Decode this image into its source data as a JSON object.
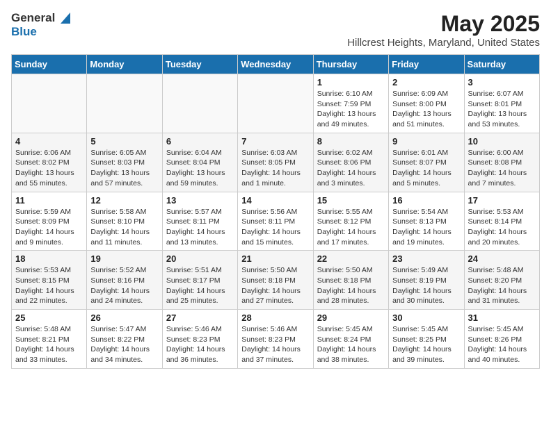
{
  "header": {
    "logo_general": "General",
    "logo_blue": "Blue",
    "month_year": "May 2025",
    "location": "Hillcrest Heights, Maryland, United States"
  },
  "weekdays": [
    "Sunday",
    "Monday",
    "Tuesday",
    "Wednesday",
    "Thursday",
    "Friday",
    "Saturday"
  ],
  "weeks": [
    {
      "days": [
        {
          "num": "",
          "detail": ""
        },
        {
          "num": "",
          "detail": ""
        },
        {
          "num": "",
          "detail": ""
        },
        {
          "num": "",
          "detail": ""
        },
        {
          "num": "1",
          "detail": "Sunrise: 6:10 AM\nSunset: 7:59 PM\nDaylight: 13 hours\nand 49 minutes."
        },
        {
          "num": "2",
          "detail": "Sunrise: 6:09 AM\nSunset: 8:00 PM\nDaylight: 13 hours\nand 51 minutes."
        },
        {
          "num": "3",
          "detail": "Sunrise: 6:07 AM\nSunset: 8:01 PM\nDaylight: 13 hours\nand 53 minutes."
        }
      ]
    },
    {
      "days": [
        {
          "num": "4",
          "detail": "Sunrise: 6:06 AM\nSunset: 8:02 PM\nDaylight: 13 hours\nand 55 minutes."
        },
        {
          "num": "5",
          "detail": "Sunrise: 6:05 AM\nSunset: 8:03 PM\nDaylight: 13 hours\nand 57 minutes."
        },
        {
          "num": "6",
          "detail": "Sunrise: 6:04 AM\nSunset: 8:04 PM\nDaylight: 13 hours\nand 59 minutes."
        },
        {
          "num": "7",
          "detail": "Sunrise: 6:03 AM\nSunset: 8:05 PM\nDaylight: 14 hours\nand 1 minute."
        },
        {
          "num": "8",
          "detail": "Sunrise: 6:02 AM\nSunset: 8:06 PM\nDaylight: 14 hours\nand 3 minutes."
        },
        {
          "num": "9",
          "detail": "Sunrise: 6:01 AM\nSunset: 8:07 PM\nDaylight: 14 hours\nand 5 minutes."
        },
        {
          "num": "10",
          "detail": "Sunrise: 6:00 AM\nSunset: 8:08 PM\nDaylight: 14 hours\nand 7 minutes."
        }
      ]
    },
    {
      "days": [
        {
          "num": "11",
          "detail": "Sunrise: 5:59 AM\nSunset: 8:09 PM\nDaylight: 14 hours\nand 9 minutes."
        },
        {
          "num": "12",
          "detail": "Sunrise: 5:58 AM\nSunset: 8:10 PM\nDaylight: 14 hours\nand 11 minutes."
        },
        {
          "num": "13",
          "detail": "Sunrise: 5:57 AM\nSunset: 8:11 PM\nDaylight: 14 hours\nand 13 minutes."
        },
        {
          "num": "14",
          "detail": "Sunrise: 5:56 AM\nSunset: 8:11 PM\nDaylight: 14 hours\nand 15 minutes."
        },
        {
          "num": "15",
          "detail": "Sunrise: 5:55 AM\nSunset: 8:12 PM\nDaylight: 14 hours\nand 17 minutes."
        },
        {
          "num": "16",
          "detail": "Sunrise: 5:54 AM\nSunset: 8:13 PM\nDaylight: 14 hours\nand 19 minutes."
        },
        {
          "num": "17",
          "detail": "Sunrise: 5:53 AM\nSunset: 8:14 PM\nDaylight: 14 hours\nand 20 minutes."
        }
      ]
    },
    {
      "days": [
        {
          "num": "18",
          "detail": "Sunrise: 5:53 AM\nSunset: 8:15 PM\nDaylight: 14 hours\nand 22 minutes."
        },
        {
          "num": "19",
          "detail": "Sunrise: 5:52 AM\nSunset: 8:16 PM\nDaylight: 14 hours\nand 24 minutes."
        },
        {
          "num": "20",
          "detail": "Sunrise: 5:51 AM\nSunset: 8:17 PM\nDaylight: 14 hours\nand 25 minutes."
        },
        {
          "num": "21",
          "detail": "Sunrise: 5:50 AM\nSunset: 8:18 PM\nDaylight: 14 hours\nand 27 minutes."
        },
        {
          "num": "22",
          "detail": "Sunrise: 5:50 AM\nSunset: 8:18 PM\nDaylight: 14 hours\nand 28 minutes."
        },
        {
          "num": "23",
          "detail": "Sunrise: 5:49 AM\nSunset: 8:19 PM\nDaylight: 14 hours\nand 30 minutes."
        },
        {
          "num": "24",
          "detail": "Sunrise: 5:48 AM\nSunset: 8:20 PM\nDaylight: 14 hours\nand 31 minutes."
        }
      ]
    },
    {
      "days": [
        {
          "num": "25",
          "detail": "Sunrise: 5:48 AM\nSunset: 8:21 PM\nDaylight: 14 hours\nand 33 minutes."
        },
        {
          "num": "26",
          "detail": "Sunrise: 5:47 AM\nSunset: 8:22 PM\nDaylight: 14 hours\nand 34 minutes."
        },
        {
          "num": "27",
          "detail": "Sunrise: 5:46 AM\nSunset: 8:23 PM\nDaylight: 14 hours\nand 36 minutes."
        },
        {
          "num": "28",
          "detail": "Sunrise: 5:46 AM\nSunset: 8:23 PM\nDaylight: 14 hours\nand 37 minutes."
        },
        {
          "num": "29",
          "detail": "Sunrise: 5:45 AM\nSunset: 8:24 PM\nDaylight: 14 hours\nand 38 minutes."
        },
        {
          "num": "30",
          "detail": "Sunrise: 5:45 AM\nSunset: 8:25 PM\nDaylight: 14 hours\nand 39 minutes."
        },
        {
          "num": "31",
          "detail": "Sunrise: 5:45 AM\nSunset: 8:26 PM\nDaylight: 14 hours\nand 40 minutes."
        }
      ]
    }
  ]
}
